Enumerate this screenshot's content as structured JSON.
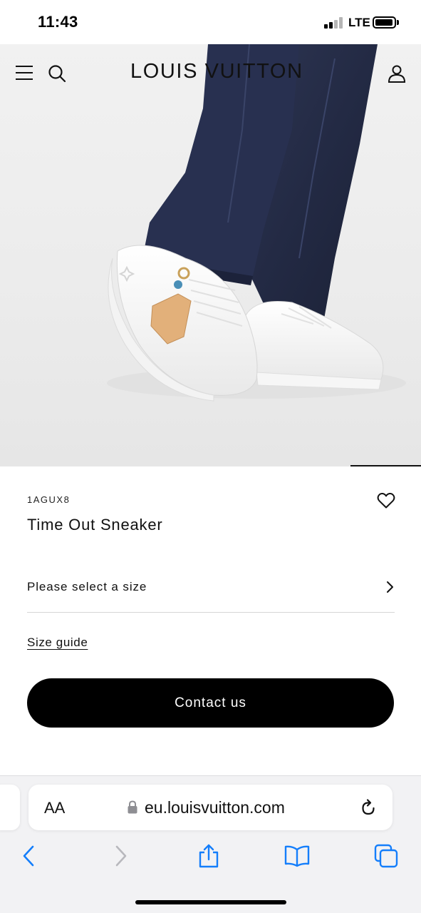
{
  "status_bar": {
    "time": "11:43",
    "network": "LTE"
  },
  "site_header": {
    "brand": "LOUIS VUITTON",
    "icons": [
      "menu-icon",
      "search-icon",
      "account-icon"
    ]
  },
  "product": {
    "sku": "1AGUX8",
    "name": "Time Out Sneaker",
    "size_prompt": "Please select a size",
    "size_guide": "Size guide",
    "contact_button": "Contact us"
  },
  "browser": {
    "text_size_label": "AA",
    "url": "eu.louisvuitton.com",
    "toolbar_icons": [
      "back-icon",
      "forward-icon",
      "share-icon",
      "bookmarks-icon",
      "tabs-icon"
    ]
  },
  "colors": {
    "accent": "#000000",
    "safari_blue": "#147efb",
    "disabled": "#b8b8bd"
  }
}
